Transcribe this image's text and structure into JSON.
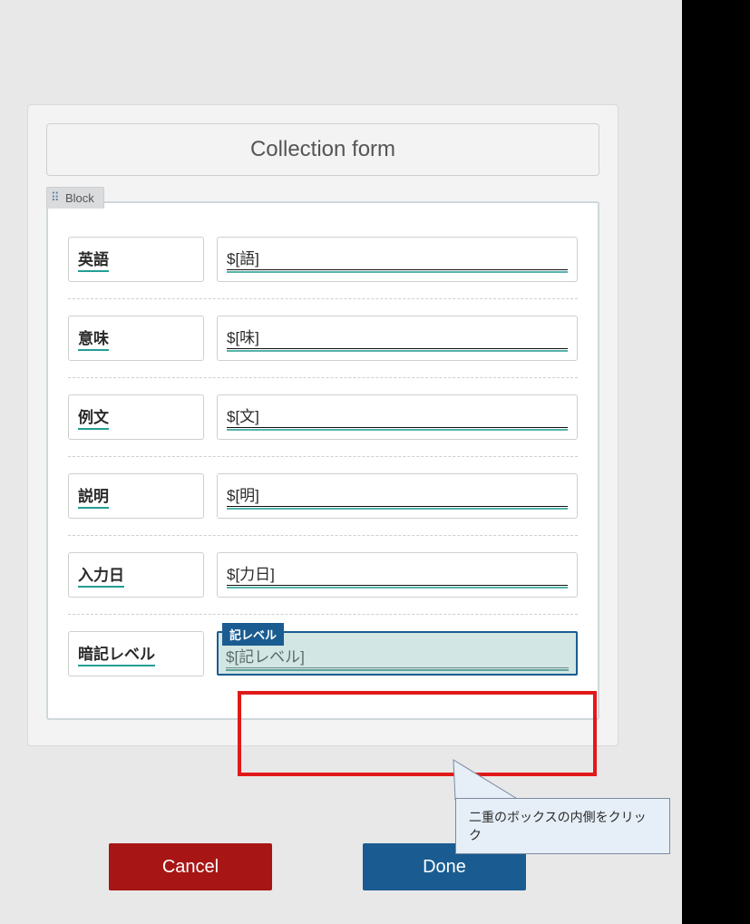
{
  "title": "Collection form",
  "block": {
    "tab_label": "Block"
  },
  "rows": [
    {
      "label": "英語",
      "value": "$[語]"
    },
    {
      "label": "意味",
      "value": "$[味]"
    },
    {
      "label": "例文",
      "value": "$[文]"
    },
    {
      "label": "説明",
      "value": "$[明]"
    },
    {
      "label": "入力日",
      "value": "$[力日]"
    },
    {
      "label": "暗記レベル",
      "value": "$[記レベル]",
      "tag": "記レベル"
    }
  ],
  "callout": {
    "text": "二重のボックスの内側をクリック"
  },
  "buttons": {
    "cancel": "Cancel",
    "done": "Done"
  }
}
